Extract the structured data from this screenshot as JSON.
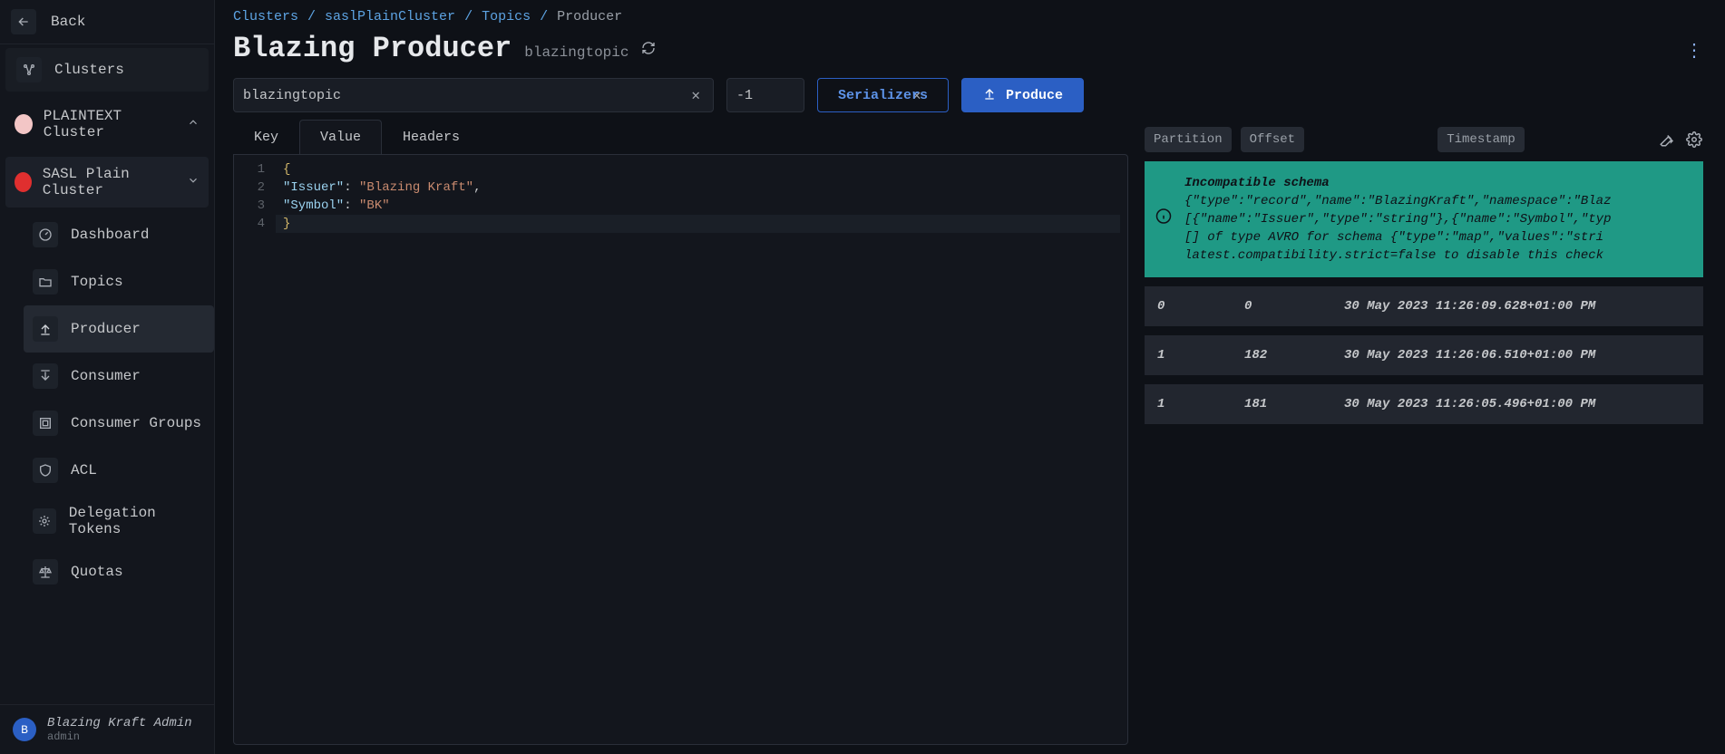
{
  "sidebar": {
    "back": "Back",
    "clusters": "Clusters",
    "cluster_plain": "PLAINTEXT Cluster",
    "cluster_sasl": "SASL Plain Cluster",
    "nav": {
      "dashboard": "Dashboard",
      "topics": "Topics",
      "producer": "Producer",
      "consumer": "Consumer",
      "consumer_groups": "Consumer Groups",
      "acl": "ACL",
      "delegation_tokens": "Delegation Tokens",
      "quotas": "Quotas"
    },
    "user": {
      "initial": "B",
      "name": "Blazing Kraft Admin",
      "sub": "admin"
    }
  },
  "breadcrumbs": {
    "clusters": "Clusters",
    "cluster": "saslPlainCluster",
    "topics": "Topics",
    "current": "Producer"
  },
  "header": {
    "title": "Blazing Producer",
    "subtitle": "blazingtopic"
  },
  "inputs": {
    "topic": "blazingtopic",
    "partition": "-1"
  },
  "buttons": {
    "serializers": "Serializers",
    "produce": "Produce"
  },
  "tabs": {
    "key": "Key",
    "value": "Value",
    "headers": "Headers"
  },
  "editor": {
    "gutter": [
      "1",
      "2",
      "3",
      "4"
    ],
    "l1": "{",
    "l2_indent": "  ",
    "l2_key": "\"Issuer\"",
    "l2_sep": ": ",
    "l2_val": "\"Blazing Kraft\"",
    "l2_end": ",",
    "l3_indent": "  ",
    "l3_key": "\"Symbol\"",
    "l3_sep": ": ",
    "l3_val": "\"BK\"",
    "l4": "}"
  },
  "results": {
    "headers": {
      "partition": "Partition",
      "offset": "Offset",
      "timestamp": "Timestamp"
    },
    "error": {
      "title": "Incompatible schema",
      "line2": "{\"type\":\"record\",\"name\":\"BlazingKraft\",\"namespace\":\"Blaz",
      "line3": "[{\"name\":\"Issuer\",\"type\":\"string\"},{\"name\":\"Symbol\",\"typ",
      "line4": "[] of type AVRO for schema {\"type\":\"map\",\"values\":\"stri",
      "line5": "latest.compatibility.strict=false to disable this check"
    },
    "rows": [
      {
        "partition": "0",
        "offset": "0",
        "timestamp": "30 May 2023 11:26:09.628+01:00 PM"
      },
      {
        "partition": "1",
        "offset": "182",
        "timestamp": "30 May 2023 11:26:06.510+01:00 PM"
      },
      {
        "partition": "1",
        "offset": "181",
        "timestamp": "30 May 2023 11:26:05.496+01:00 PM"
      }
    ]
  }
}
